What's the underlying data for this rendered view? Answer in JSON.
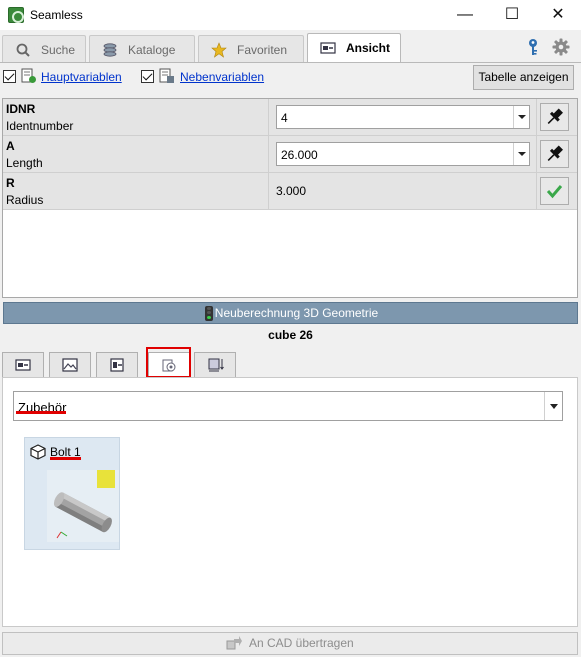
{
  "window": {
    "title": "Seamless",
    "minimize": "—",
    "maximize": "☐",
    "close": "✕"
  },
  "tabs": [
    {
      "label": "Suche",
      "icon": "search-icon"
    },
    {
      "label": "Kataloge",
      "icon": "catalog-icon"
    },
    {
      "label": "Favoriten",
      "icon": "star-icon"
    },
    {
      "label": "Ansicht",
      "icon": "view-icon",
      "active": true
    }
  ],
  "options": {
    "hauptvariablen": {
      "label": "Hauptvariablen",
      "checked": true
    },
    "nebenvariablen": {
      "label": "Nebenvariablen",
      "checked": true
    },
    "table_button": "Tabelle anzeigen"
  },
  "variables": [
    {
      "name": "IDNR",
      "desc": "Identnumber",
      "value": "4",
      "type": "combo",
      "action": "pin-icon"
    },
    {
      "name": "A",
      "desc": "Length",
      "value": "26.000",
      "type": "combo",
      "action": "pin-icon"
    },
    {
      "name": "R",
      "desc": "Radius",
      "value": "3.000",
      "type": "static",
      "action": "check-icon"
    }
  ],
  "recalc_label": "Neuberechnung 3D Geometrie",
  "part_name": "cube 26",
  "view_tabs": [
    "view-tab-1",
    "view-tab-2",
    "view-tab-3",
    "view-tab-accessories",
    "view-tab-5"
  ],
  "accessory_select": "Zubehör",
  "accessories": [
    {
      "label": "Bolt 1",
      "icon": "cube-icon"
    }
  ],
  "transfer_label": "An CAD übertragen",
  "colors": {
    "accent": "#7d97ae",
    "highlight": "#e00000",
    "link": "#0033cc"
  }
}
